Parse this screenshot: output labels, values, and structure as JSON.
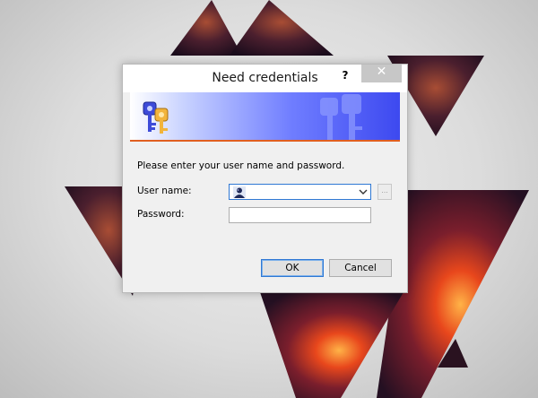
{
  "dialog": {
    "title": "Need credentials",
    "help_label": "?",
    "close_label": "✕",
    "prompt": "Please enter your user name and password.",
    "username_label": "User name:",
    "username_value": "",
    "password_label": "Password:",
    "password_value": "",
    "browse_label": "...",
    "ok_label": "OK",
    "cancel_label": "Cancel"
  },
  "colors": {
    "banner_start": "#ffffff",
    "banner_end": "#3d49f0",
    "banner_stripe": "#e05f20",
    "focus_border": "#2f78d4"
  },
  "icons": {
    "banner": "keys-icon",
    "banner_watermark": "keys-watermark-icon",
    "user": "user-avatar-icon",
    "dropdown": "chevron-down-icon"
  }
}
